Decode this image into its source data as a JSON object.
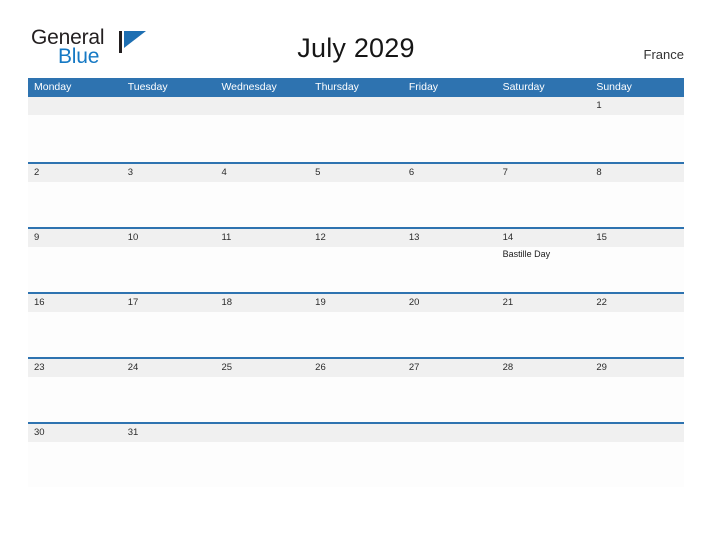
{
  "brand": {
    "word1": "General",
    "word2": "Blue",
    "flag_icon": "blue-triangle-flag-icon",
    "word1_color": "#231f20",
    "word2_color": "#1679c4"
  },
  "header": {
    "title": "July 2029",
    "country": "France"
  },
  "theme": {
    "header_blue": "#2e73b0",
    "band_gray": "#f0f0f0",
    "cell_white": "#fdfdfd",
    "text_dark": "#2b2b2b"
  },
  "calendar": {
    "weekdays": [
      "Monday",
      "Tuesday",
      "Wednesday",
      "Thursday",
      "Friday",
      "Saturday",
      "Sunday"
    ],
    "weeks": [
      {
        "days": [
          {
            "num": ""
          },
          {
            "num": ""
          },
          {
            "num": ""
          },
          {
            "num": ""
          },
          {
            "num": ""
          },
          {
            "num": ""
          },
          {
            "num": "1"
          }
        ]
      },
      {
        "days": [
          {
            "num": "2"
          },
          {
            "num": "3"
          },
          {
            "num": "4"
          },
          {
            "num": "5"
          },
          {
            "num": "6"
          },
          {
            "num": "7"
          },
          {
            "num": "8"
          }
        ]
      },
      {
        "days": [
          {
            "num": "9"
          },
          {
            "num": "10"
          },
          {
            "num": "11"
          },
          {
            "num": "12"
          },
          {
            "num": "13"
          },
          {
            "num": "14",
            "event": "Bastille Day"
          },
          {
            "num": "15"
          }
        ]
      },
      {
        "days": [
          {
            "num": "16"
          },
          {
            "num": "17"
          },
          {
            "num": "18"
          },
          {
            "num": "19"
          },
          {
            "num": "20"
          },
          {
            "num": "21"
          },
          {
            "num": "22"
          }
        ]
      },
      {
        "days": [
          {
            "num": "23"
          },
          {
            "num": "24"
          },
          {
            "num": "25"
          },
          {
            "num": "26"
          },
          {
            "num": "27"
          },
          {
            "num": "28"
          },
          {
            "num": "29"
          }
        ]
      },
      {
        "days": [
          {
            "num": "30"
          },
          {
            "num": "31"
          },
          {
            "num": ""
          },
          {
            "num": ""
          },
          {
            "num": ""
          },
          {
            "num": ""
          },
          {
            "num": ""
          }
        ]
      }
    ]
  }
}
